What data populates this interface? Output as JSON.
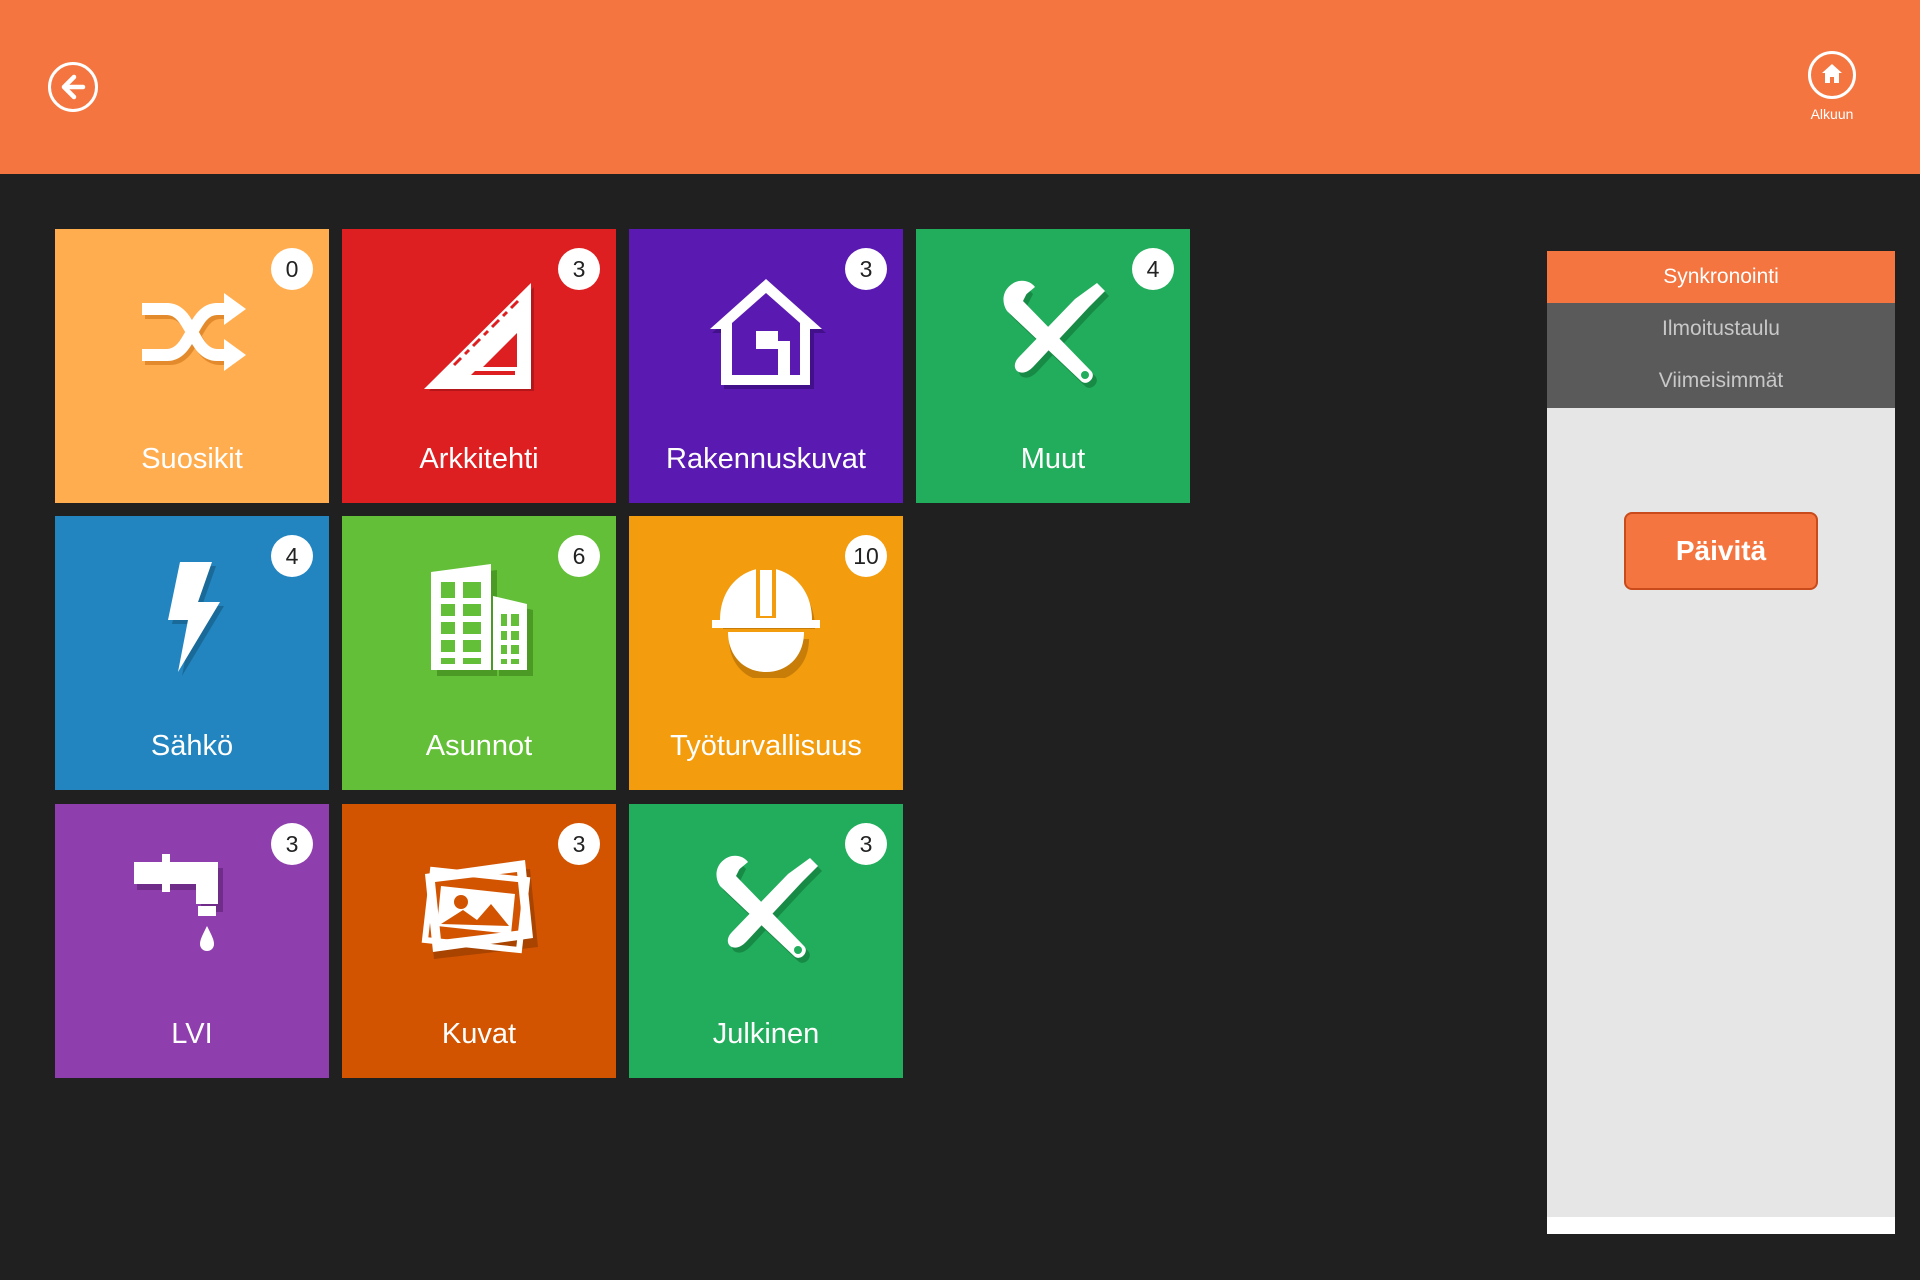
{
  "header": {
    "back_icon": "arrow-left-icon",
    "home_icon": "home-icon",
    "home_label": "Alkuun",
    "background": "#f4753f"
  },
  "tiles": [
    {
      "label": "Suosikit",
      "count": "0",
      "icon": "shuffle-icon",
      "color": "#ffad4f"
    },
    {
      "label": "Arkkitehti",
      "count": "3",
      "icon": "set-square-icon",
      "color": "#de1f22"
    },
    {
      "label": "Rakennuskuvat",
      "count": "3",
      "icon": "house-icon",
      "color": "#5a1ab2"
    },
    {
      "label": "Muut",
      "count": "4",
      "icon": "tools-icon",
      "color": "#22ad5c"
    },
    {
      "label": "Sähkö",
      "count": "4",
      "icon": "lightning-icon",
      "color": "#2385c0"
    },
    {
      "label": "Asunnot",
      "count": "6",
      "icon": "building-icon",
      "color": "#63bf37"
    },
    {
      "label": "Työturvallisuus",
      "count": "10",
      "icon": "hard-hat-icon",
      "color": "#f39c0e"
    },
    {
      "label": "LVI",
      "count": "3",
      "icon": "faucet-icon",
      "color": "#8f3fad"
    },
    {
      "label": "Kuvat",
      "count": "3",
      "icon": "photos-icon",
      "color": "#d35400"
    },
    {
      "label": "Julkinen",
      "count": "3",
      "icon": "tools-icon",
      "color": "#22ad5c"
    }
  ],
  "side_panel": {
    "tabs": [
      {
        "label": "Synkronointi",
        "active": true
      },
      {
        "label": "Ilmoitustaulu",
        "active": false
      },
      {
        "label": "Viimeisimmät",
        "active": false
      }
    ],
    "update_button": "Päivitä"
  }
}
